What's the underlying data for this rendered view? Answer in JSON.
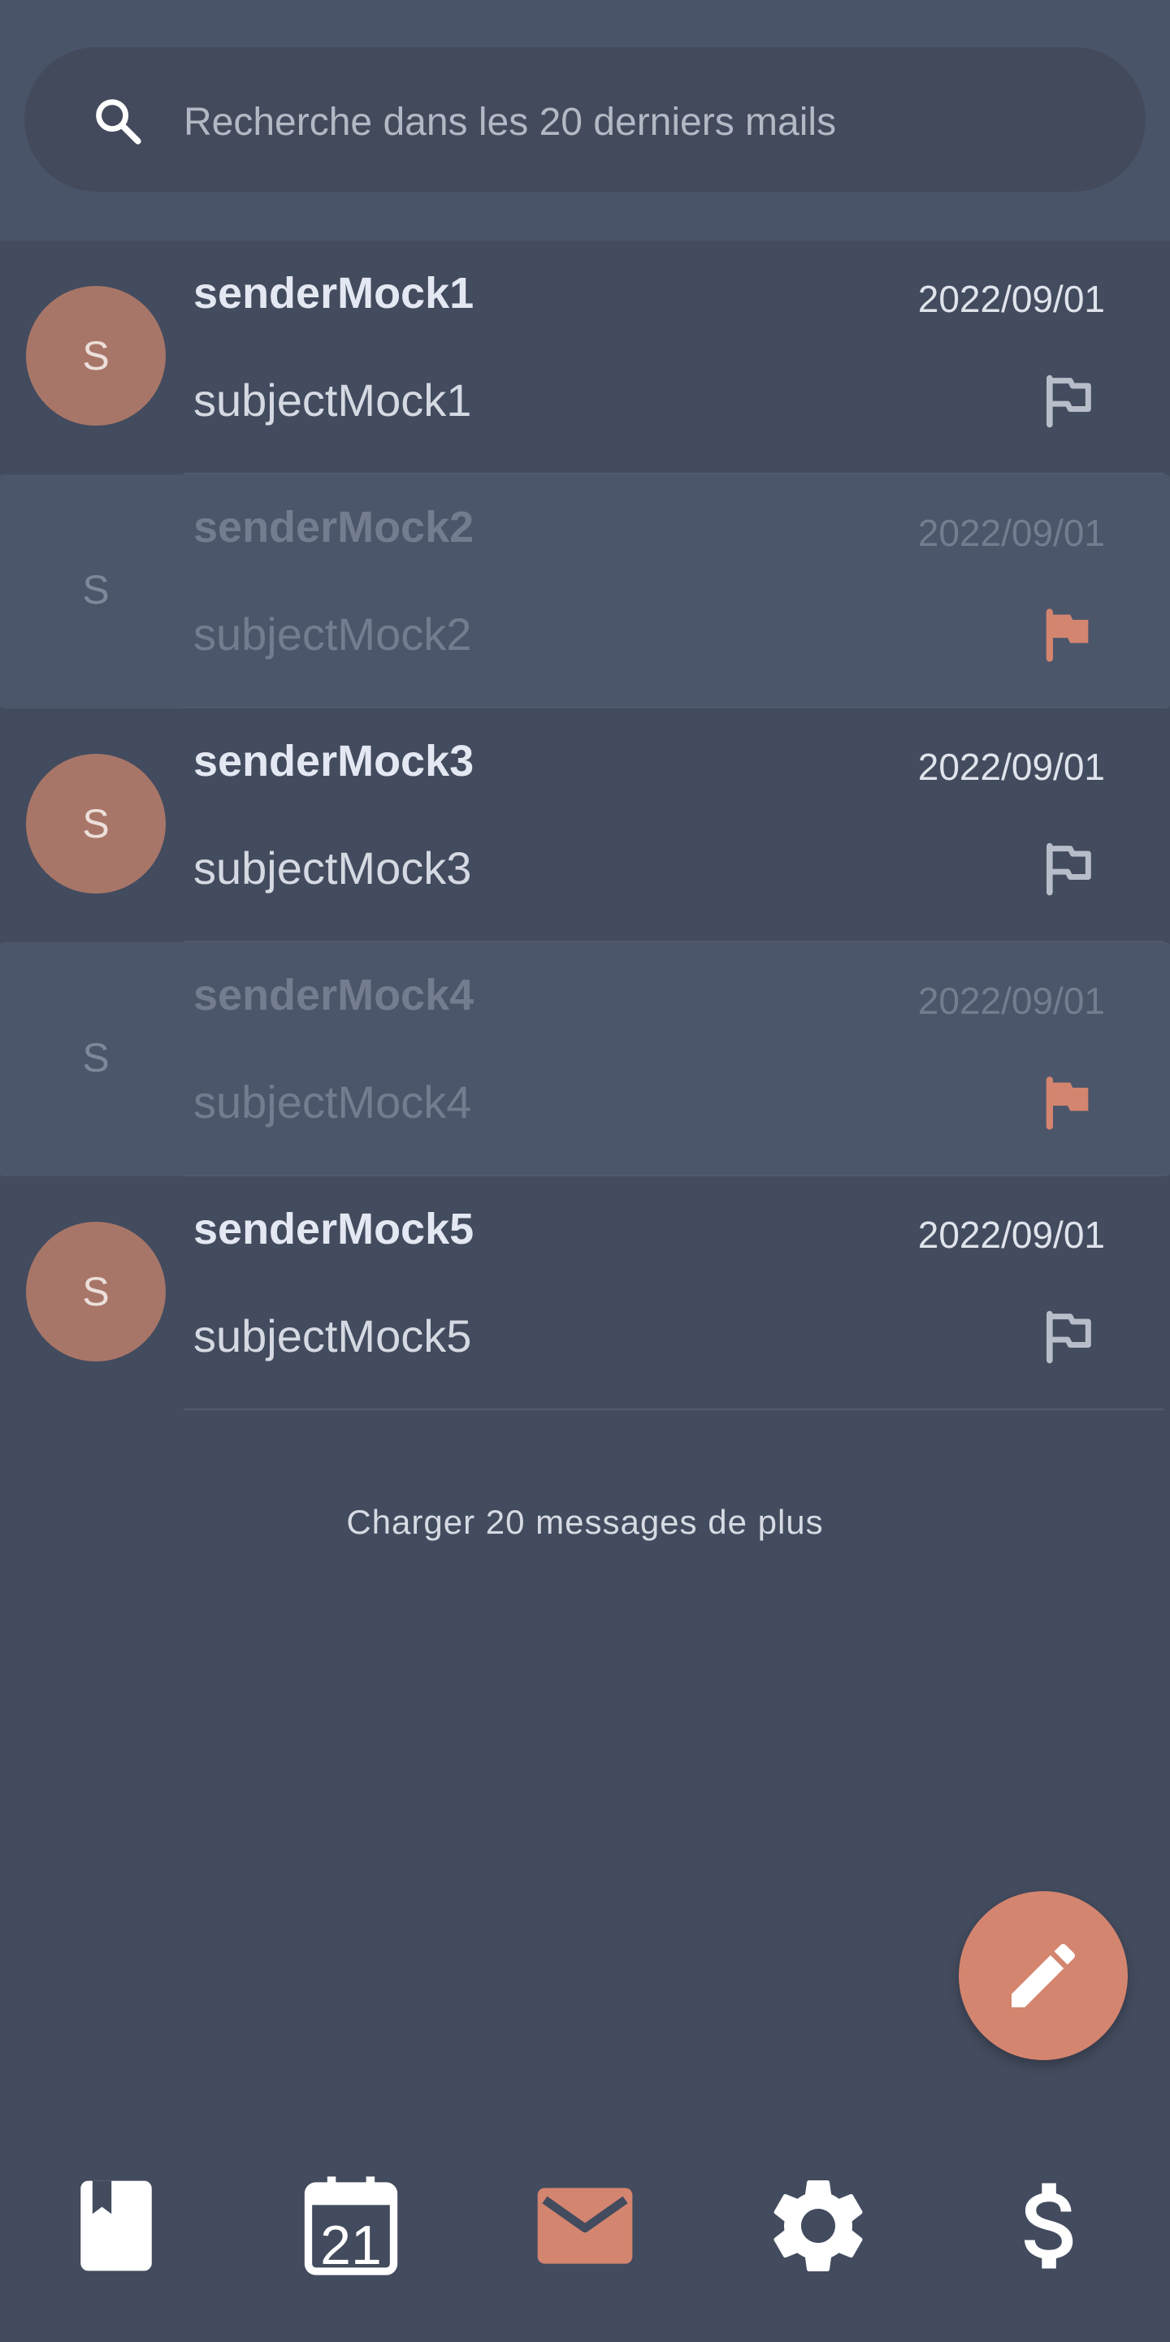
{
  "search": {
    "placeholder": "Recherche dans les 20 derniers mails",
    "icon": "search-icon"
  },
  "mails": [
    {
      "avatar": "S",
      "sender": "senderMock1",
      "date": "2022/09/01",
      "subject": "subjectMock1",
      "flagged": false,
      "selected": false
    },
    {
      "avatar": "S",
      "sender": "senderMock2",
      "date": "2022/09/01",
      "subject": "subjectMock2",
      "flagged": true,
      "selected": true
    },
    {
      "avatar": "S",
      "sender": "senderMock3",
      "date": "2022/09/01",
      "subject": "subjectMock3",
      "flagged": false,
      "selected": false
    },
    {
      "avatar": "S",
      "sender": "senderMock4",
      "date": "2022/09/01",
      "subject": "subjectMock4",
      "flagged": true,
      "selected": true
    },
    {
      "avatar": "S",
      "sender": "senderMock5",
      "date": "2022/09/01",
      "subject": "subjectMock5",
      "flagged": false,
      "selected": false
    }
  ],
  "load_more": "Charger 20 messages de plus",
  "fab": {
    "icon": "pencil-icon"
  },
  "bottom_nav": {
    "items": [
      {
        "name": "book-icon",
        "active": false
      },
      {
        "name": "calendar-icon",
        "active": false,
        "day": "21"
      },
      {
        "name": "mail-icon",
        "active": true
      },
      {
        "name": "gear-icon",
        "active": false
      },
      {
        "name": "dollar-icon",
        "active": false
      }
    ]
  },
  "colors": {
    "background": "#434b5e",
    "header": "#4a5469",
    "search_box": "#424a5c",
    "accent": "#d4856f",
    "avatar": "#a87668",
    "selected_row": "#4c566b"
  }
}
